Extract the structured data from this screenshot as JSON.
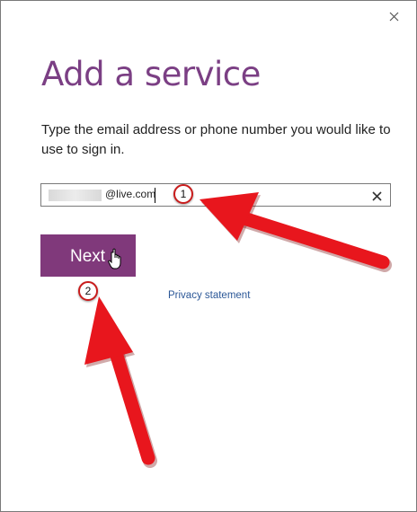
{
  "dialog": {
    "title": "Add a service",
    "description": "Type the email address or phone number you would like to use to sign in.",
    "close_icon": "close-icon"
  },
  "email_input": {
    "value_suffix": "@live.com",
    "clear_icon": "clear-icon"
  },
  "next_button": {
    "label": "Next"
  },
  "privacy_link": {
    "label": "Privacy statement"
  },
  "annotations": {
    "step_1": "1",
    "step_2": "2",
    "arrow_color": "#e8161d"
  },
  "colors": {
    "title": "#7b3f84",
    "button": "#80397b",
    "link": "#2b5797"
  }
}
